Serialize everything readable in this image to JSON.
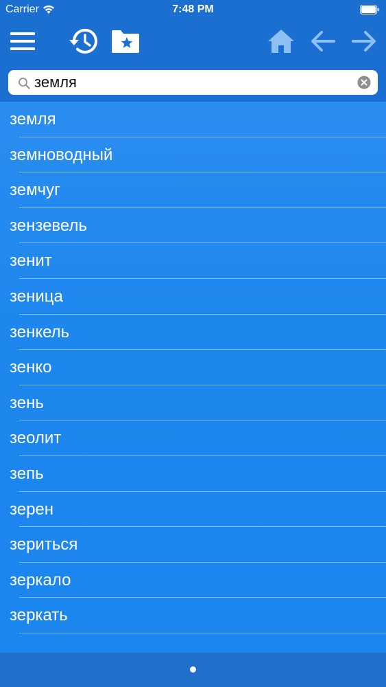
{
  "status_bar": {
    "carrier": "Carrier",
    "time": "7:48 PM"
  },
  "toolbar": {
    "icons": {
      "menu": "hamburger-menu-icon",
      "history": "history-icon",
      "favorites": "favorites-folder-icon",
      "home": "home-icon",
      "back": "arrow-left-icon",
      "forward": "arrow-right-icon"
    }
  },
  "search": {
    "value": "земля"
  },
  "words": [
    "земля",
    "земноводный",
    "земчуг",
    "зензевель",
    "зенит",
    "зеница",
    "зенкель",
    "зенко",
    "зень",
    "зеолит",
    "зепь",
    "зерен",
    "зериться",
    "зеркало",
    "зеркать"
  ],
  "colors": {
    "header": "#1b6fd0",
    "list_top": "#2a8df0",
    "list_bottom": "#1c86ef",
    "disabled_icon": "#8fc0f5"
  }
}
